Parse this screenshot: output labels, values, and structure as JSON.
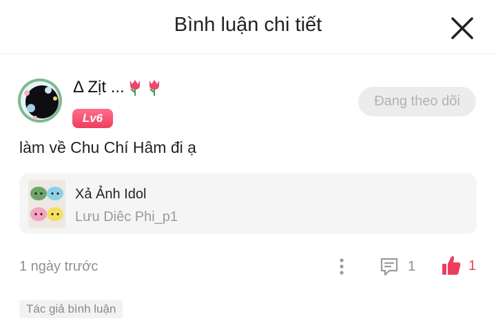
{
  "header": {
    "title": "Bình luận chi tiết"
  },
  "comment": {
    "username": "Δ Zịt ...",
    "level": "Lv6",
    "follow_label": "Đang theo dõi",
    "text": "làm về Chu Chí Hâm đi ạ",
    "time": "1 ngày trước",
    "reply_count": "1",
    "like_count": "1",
    "author_tag": "Tác giả bình luận"
  },
  "article": {
    "title": "Xả Ảnh Idol",
    "subtitle": "Lưu Diêc Phi_p1"
  },
  "icons": {
    "close": "close-icon",
    "more": "more-vertical-icon",
    "comment": "comment-icon",
    "like": "thumbs-up-icon",
    "tulip": "tulip-emoji"
  },
  "colors": {
    "accent": "#ee3e5e",
    "muted_text": "#8f8f8f",
    "follow_bg": "#ececec"
  }
}
